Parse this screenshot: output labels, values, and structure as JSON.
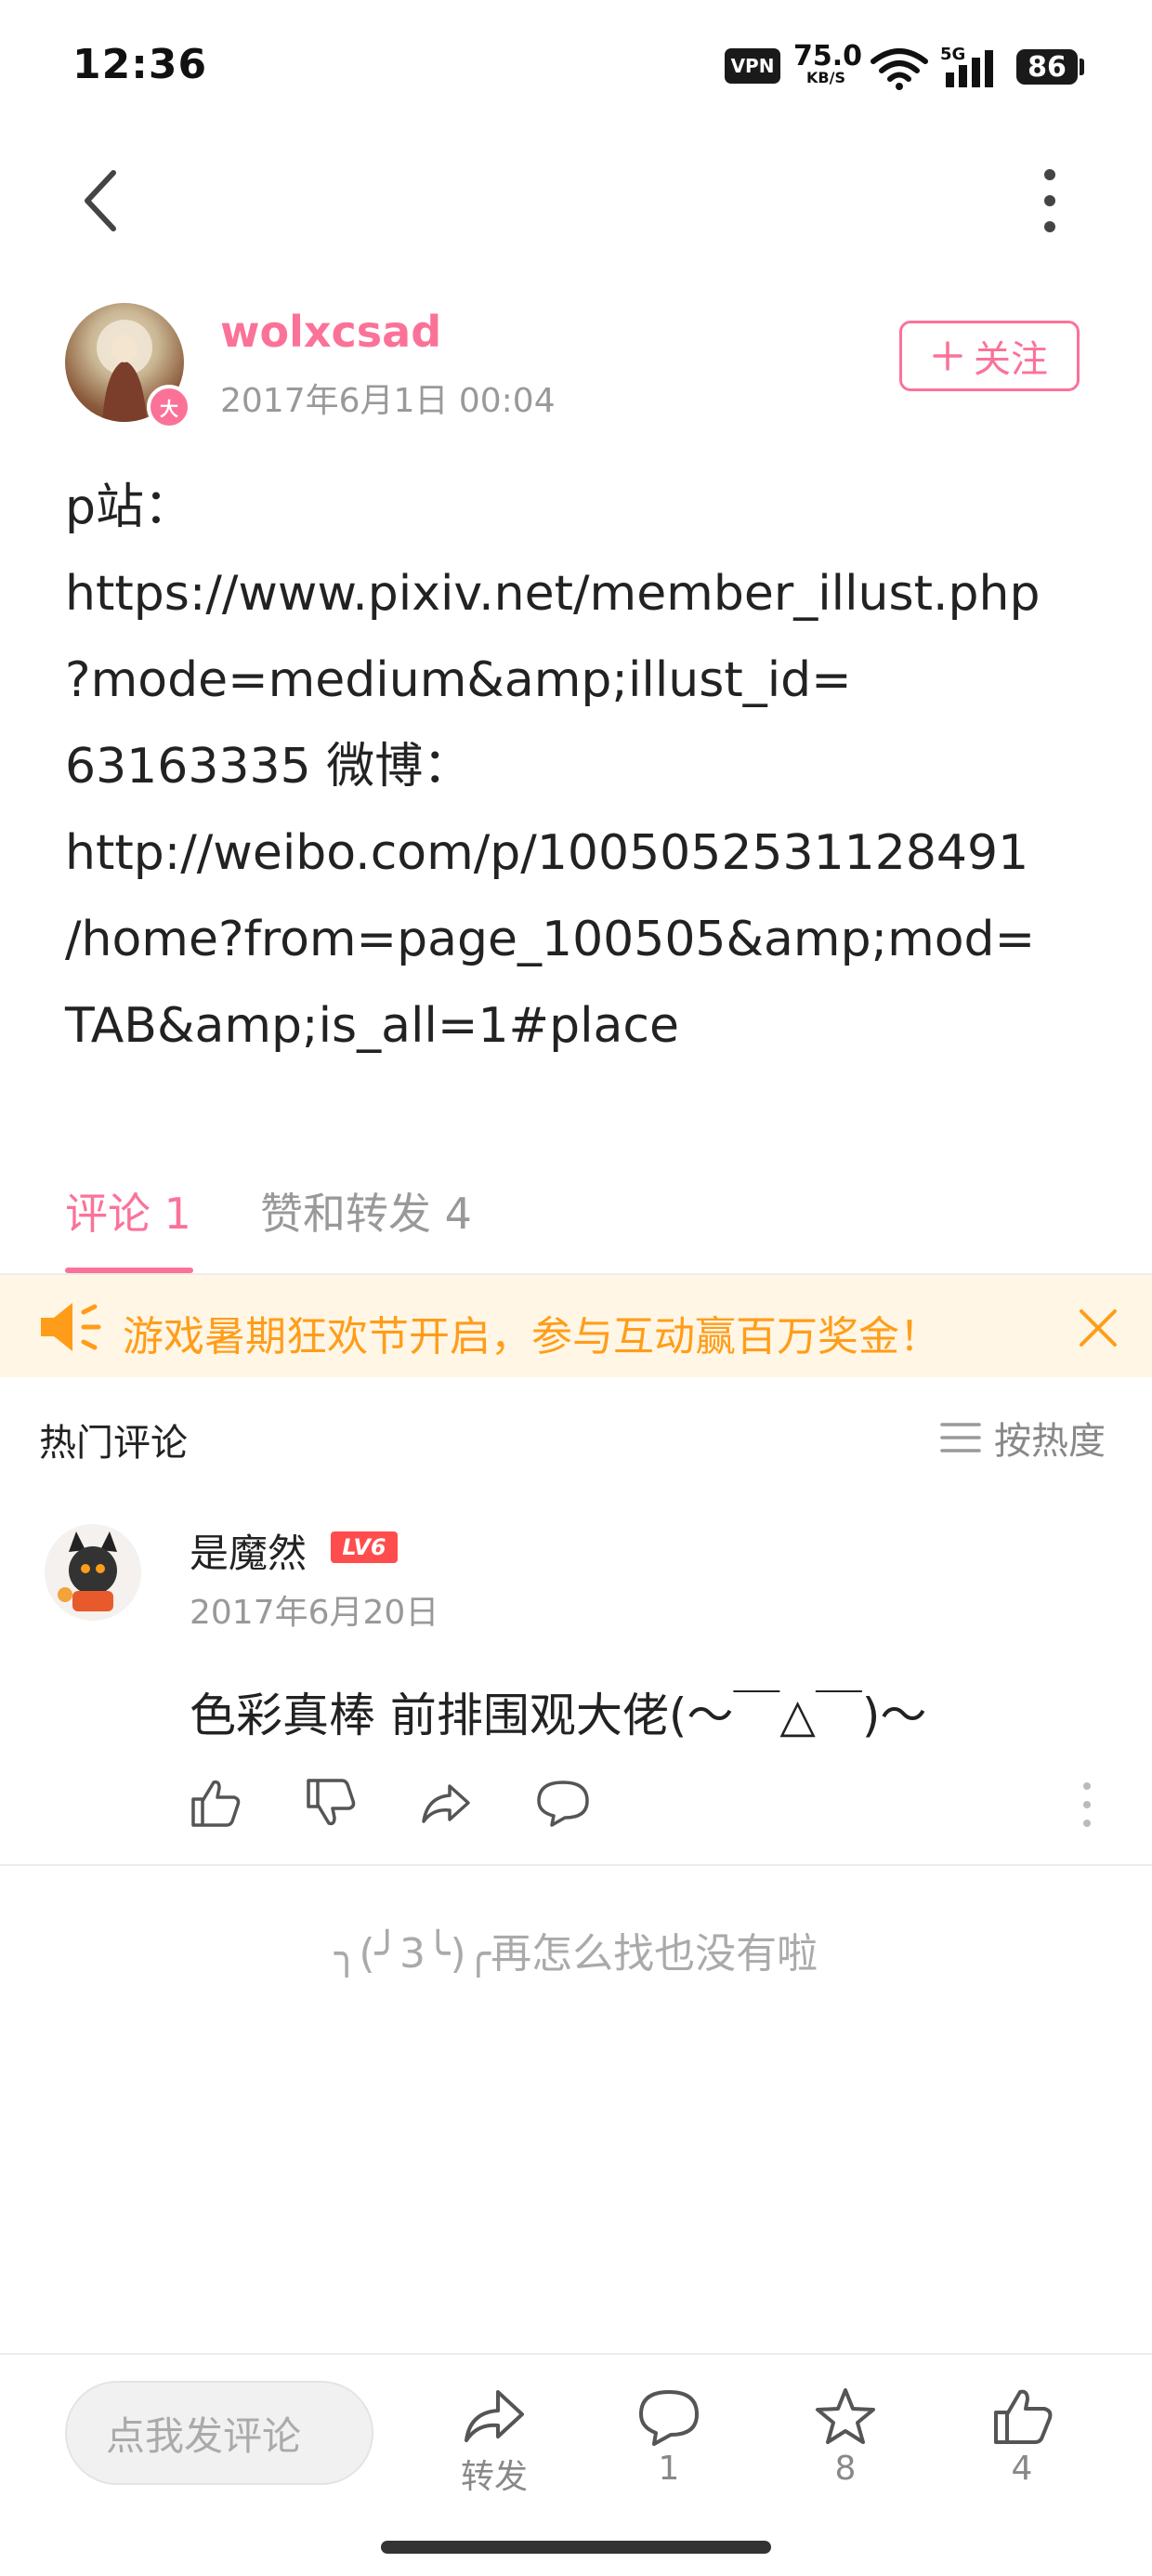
{
  "status_bar": {
    "time": "12:36",
    "vpn": "VPN",
    "speed_value": "75.0",
    "speed_unit": "KB/S",
    "network": "5G",
    "battery": "86"
  },
  "post": {
    "author": {
      "name": "wolxcsad",
      "time": "2017年6月1日 00:04",
      "badge": "大"
    },
    "follow_label": "关注",
    "content_lines": [
      "p站：",
      "https://www.pixiv.net/member_illust.php",
      "?mode=medium&amp;illust_id=",
      "63163335 微博：",
      "http://weibo.com/p/1005052531128491",
      "/home?from=page_100505&amp;mod=",
      "TAB&amp;is_all=1#place"
    ]
  },
  "tabs": [
    {
      "label": "评论 1"
    },
    {
      "label": "赞和转发 4"
    }
  ],
  "notice": {
    "text": "游戏暑期狂欢节开启，参与互动赢百万奖金！"
  },
  "comments_header": {
    "title": "热门评论",
    "sort_label": "按热度"
  },
  "comments": [
    {
      "name": "是魔然",
      "level": "LV6",
      "time": "2017年6月20日",
      "text": "色彩真棒 前排围观大佬(〜￣△￣)〜"
    }
  ],
  "end_text": "╮(╯3╰)╭再怎么找也没有啦",
  "bottom_bar": {
    "input_placeholder": "点我发评论",
    "share_label": "转发",
    "comment_count": "1",
    "favorite_count": "8",
    "like_count": "4"
  },
  "colors": {
    "accent": "#fb7299",
    "notice_bg": "#fff6e5",
    "notice_text": "#ff9d1a",
    "level_badge": "#ff4d4d"
  }
}
